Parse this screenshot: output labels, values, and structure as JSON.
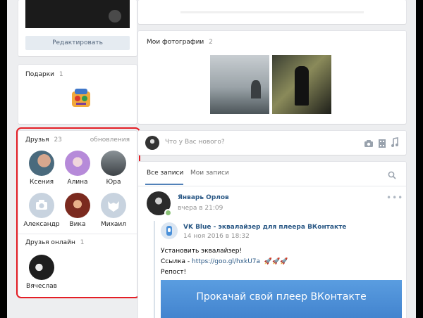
{
  "profile": {
    "edit_button": "Редактировать"
  },
  "gifts": {
    "label": "Подарки",
    "count": "1"
  },
  "friends": {
    "label": "Друзья",
    "count": "23",
    "updates_link": "обновления",
    "items": [
      {
        "name": "Ксения"
      },
      {
        "name": "Алина"
      },
      {
        "name": "Юра"
      },
      {
        "name": "Александр"
      },
      {
        "name": "Вика"
      },
      {
        "name": "Михаил"
      }
    ],
    "online_label": "Друзья онлайн",
    "online_count": "1",
    "online_items": [
      {
        "name": "Вячеслав"
      }
    ]
  },
  "photos": {
    "label": "Мои фотографии",
    "count": "2"
  },
  "composer": {
    "placeholder": "Что у Вас нового?"
  },
  "wall": {
    "tab_all": "Все записи",
    "tab_mine": "Мои записи"
  },
  "post": {
    "author": "Январь Орлов",
    "time": "вчера в 21:09",
    "repost": {
      "source": "VK Blue - эквалайзер для плеера ВКонтакте",
      "date": "14 ноя 2016 в 18:32",
      "line1": "Установить эквалайзер!",
      "line2_prefix": "Ссылка - ",
      "line2_link": "https://goo.gl/hxkU7a",
      "line2_emoji": "🚀🚀🚀",
      "line3": "Репост!",
      "banner": "Прокачай свой плеер ВКонтакте"
    }
  },
  "colors": {
    "highlight": "#e41e26",
    "link": "#2a5885",
    "accent": "#5181b8",
    "banner": "#4a90d9"
  }
}
